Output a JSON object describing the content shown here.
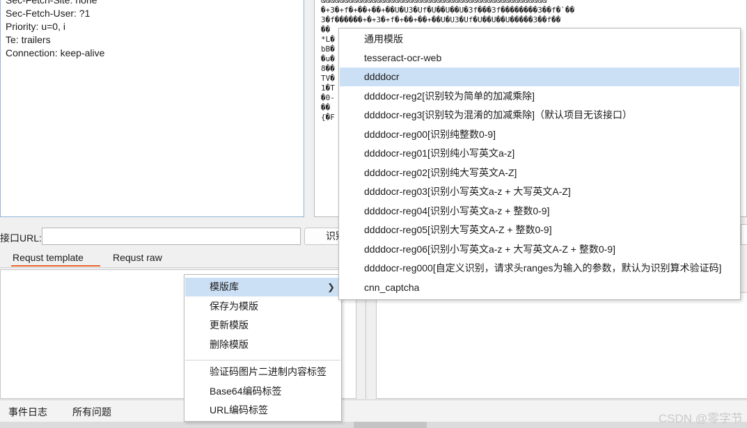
{
  "request_headers": {
    "cut_line": "Sec-Fetch-Site: none",
    "lines": [
      "Sec-Fetch-User: ?1",
      "Priority: u=0, i",
      "Te: trailers",
      "Connection: keep-alive"
    ]
  },
  "response_body": {
    "lines": [
      "&&&&&&&&&&&&&&&&&&&&&&&&&&&&&&&&&&&&&&&&&&&&&&&&&",
      "�+3�+f�+��+��+��U�U3�Uf�U��U��U�3f���3f��������3��f�`��",
      "3�f������+�+3�+f�+��+��+��U�U3�Uf�U��U��U�����3��f��",
      "��",
      "*L�",
      "bB�",
      "�u�",
      "8��",
      "TV�",
      "1�T",
      "�0-",
      "��",
      "{�F"
    ]
  },
  "url_bar": {
    "label": "接口URL:",
    "value": "",
    "recognize_button": "识别"
  },
  "tabs": [
    {
      "label": "Requst template",
      "active": true
    },
    {
      "label": "Requst raw",
      "active": false
    }
  ],
  "context_menu": {
    "items": [
      {
        "label": "模版库",
        "has_submenu": true,
        "active": true
      },
      {
        "label": "保存为模版"
      },
      {
        "label": "更新模版"
      },
      {
        "label": "删除模版"
      },
      {
        "label": "验证码图片二进制内容标签"
      },
      {
        "label": "Base64编码标签"
      },
      {
        "label": "URL编码标签"
      }
    ],
    "arrow": "❯"
  },
  "submenu": {
    "items": [
      {
        "label": "通用模版"
      },
      {
        "label": "tesseract-ocr-web"
      },
      {
        "label": "ddddocr",
        "active": true
      },
      {
        "label": "ddddocr-reg2[识别较为简单的加减乘除]"
      },
      {
        "label": "ddddocr-reg3[识别较为混淆的加减乘除]（默认项目无该接口）"
      },
      {
        "label": "ddddocr-reg00[识别纯整数0-9]"
      },
      {
        "label": "ddddocr-reg01[识别纯小写英文a-z]"
      },
      {
        "label": "ddddocr-reg02[识别纯大写英文A-Z]"
      },
      {
        "label": "ddddocr-reg03[识别小写英文a-z + 大写英文A-Z]"
      },
      {
        "label": "ddddocr-reg04[识别小写英文a-z + 整数0-9]"
      },
      {
        "label": "ddddocr-reg05[识别大写英文A-Z + 整数0-9]"
      },
      {
        "label": "ddddocr-reg06[识别小写英文a-z + 大写英文A-Z + 整数0-9]"
      },
      {
        "label": "ddddocr-reg000[自定义识别，请求头ranges为输入的参数，默认为识别算术验证码]"
      },
      {
        "label": "cnn_captcha"
      }
    ]
  },
  "status_bar": {
    "tabs": [
      "事件日志",
      "所有问题"
    ]
  },
  "watermark": "CSDN @零字节",
  "colors": {
    "highlight": "#cce0f5",
    "active_tab_underline": "#e8632b",
    "panel_border_blue": "#8fb3d9"
  }
}
